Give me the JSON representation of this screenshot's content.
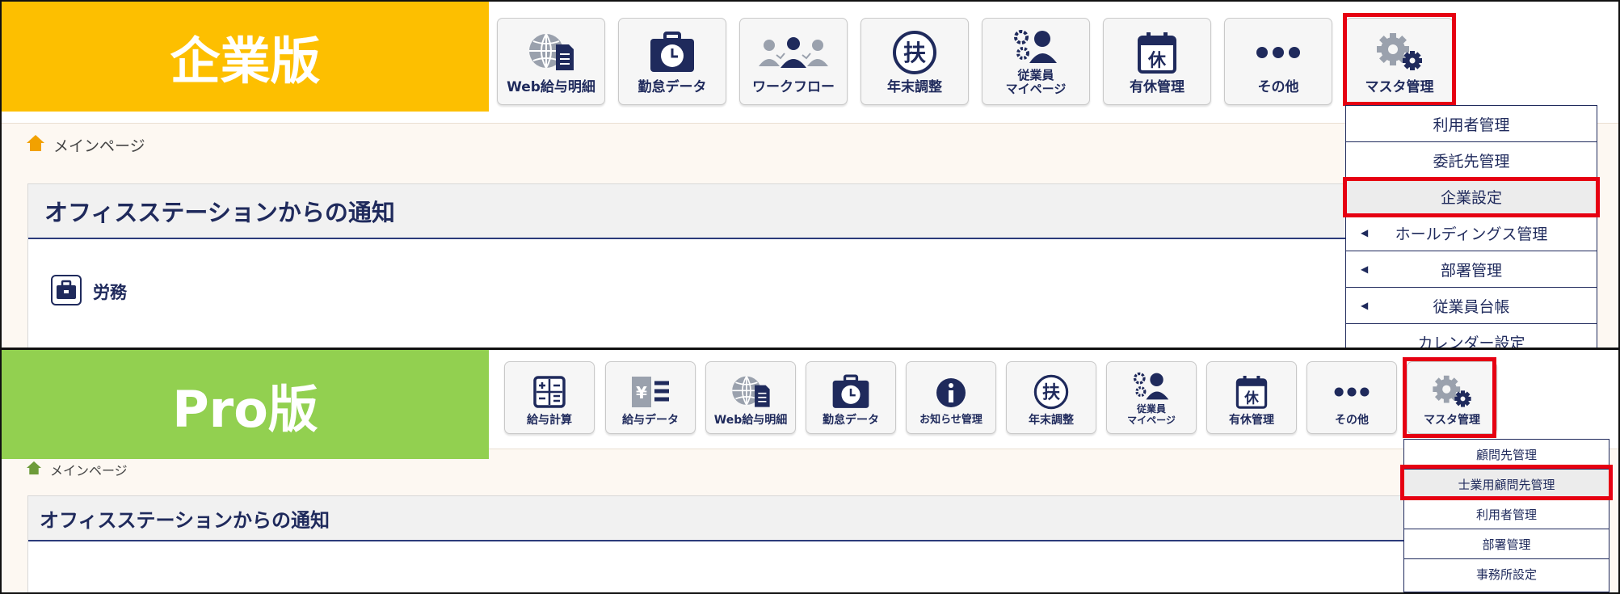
{
  "enterprise": {
    "edition_label": "企業版",
    "nav": [
      {
        "label": "Web給与明細",
        "icon": "globe-document-icon"
      },
      {
        "label": "勤怠データ",
        "icon": "clock-briefcase-icon"
      },
      {
        "label": "ワークフロー",
        "icon": "people-group-icon"
      },
      {
        "label": "年末調整",
        "icon": "fu-kanji-icon"
      },
      {
        "label": "従業員\nマイページ",
        "icon": "employee-gear-icon"
      },
      {
        "label": "有休管理",
        "icon": "calendar-kyu-icon"
      },
      {
        "label": "その他",
        "icon": "more-dots-icon"
      },
      {
        "label": "マスタ管理",
        "icon": "gears-icon"
      }
    ],
    "breadcrumb": "メインページ",
    "notice_title": "オフィスステーションからの通知",
    "category_label": "労務",
    "master_menu": [
      {
        "label": "利用者管理",
        "arrow": false
      },
      {
        "label": "委託先管理",
        "arrow": false
      },
      {
        "label": "企業設定",
        "arrow": false,
        "selected": true
      },
      {
        "label": "ホールディングス管理",
        "arrow": true
      },
      {
        "label": "部署管理",
        "arrow": true
      },
      {
        "label": "従業員台帳",
        "arrow": true
      },
      {
        "label": "カレンダー設定",
        "arrow": false
      }
    ]
  },
  "pro": {
    "edition_label": "Pro版",
    "nav": [
      {
        "label": "給与計算",
        "icon": "calculator-icon"
      },
      {
        "label": "給与データ",
        "icon": "yen-list-icon"
      },
      {
        "label": "Web給与明細",
        "icon": "globe-document-icon"
      },
      {
        "label": "勤怠データ",
        "icon": "clock-briefcase-icon"
      },
      {
        "label": "お知らせ管理",
        "icon": "info-icon"
      },
      {
        "label": "年末調整",
        "icon": "fu-kanji-icon"
      },
      {
        "label": "従業員\nマイページ",
        "icon": "employee-gear-icon"
      },
      {
        "label": "有休管理",
        "icon": "calendar-kyu-icon"
      },
      {
        "label": "その他",
        "icon": "more-dots-icon"
      },
      {
        "label": "マスタ管理",
        "icon": "gears-icon"
      }
    ],
    "breadcrumb": "メインページ",
    "notice_title": "オフィスステーションからの通知",
    "master_menu": [
      {
        "label": "顧問先管理",
        "selected": false
      },
      {
        "label": "士業用顧問先管理",
        "selected": true
      },
      {
        "label": "利用者管理",
        "selected": false
      },
      {
        "label": "部署管理",
        "selected": false
      },
      {
        "label": "事務所設定",
        "selected": false
      }
    ]
  },
  "colors": {
    "navy": "#1f2a5c",
    "enterprise_banner": "#fdbf00",
    "pro_banner": "#92d050",
    "highlight": "#e60012"
  }
}
